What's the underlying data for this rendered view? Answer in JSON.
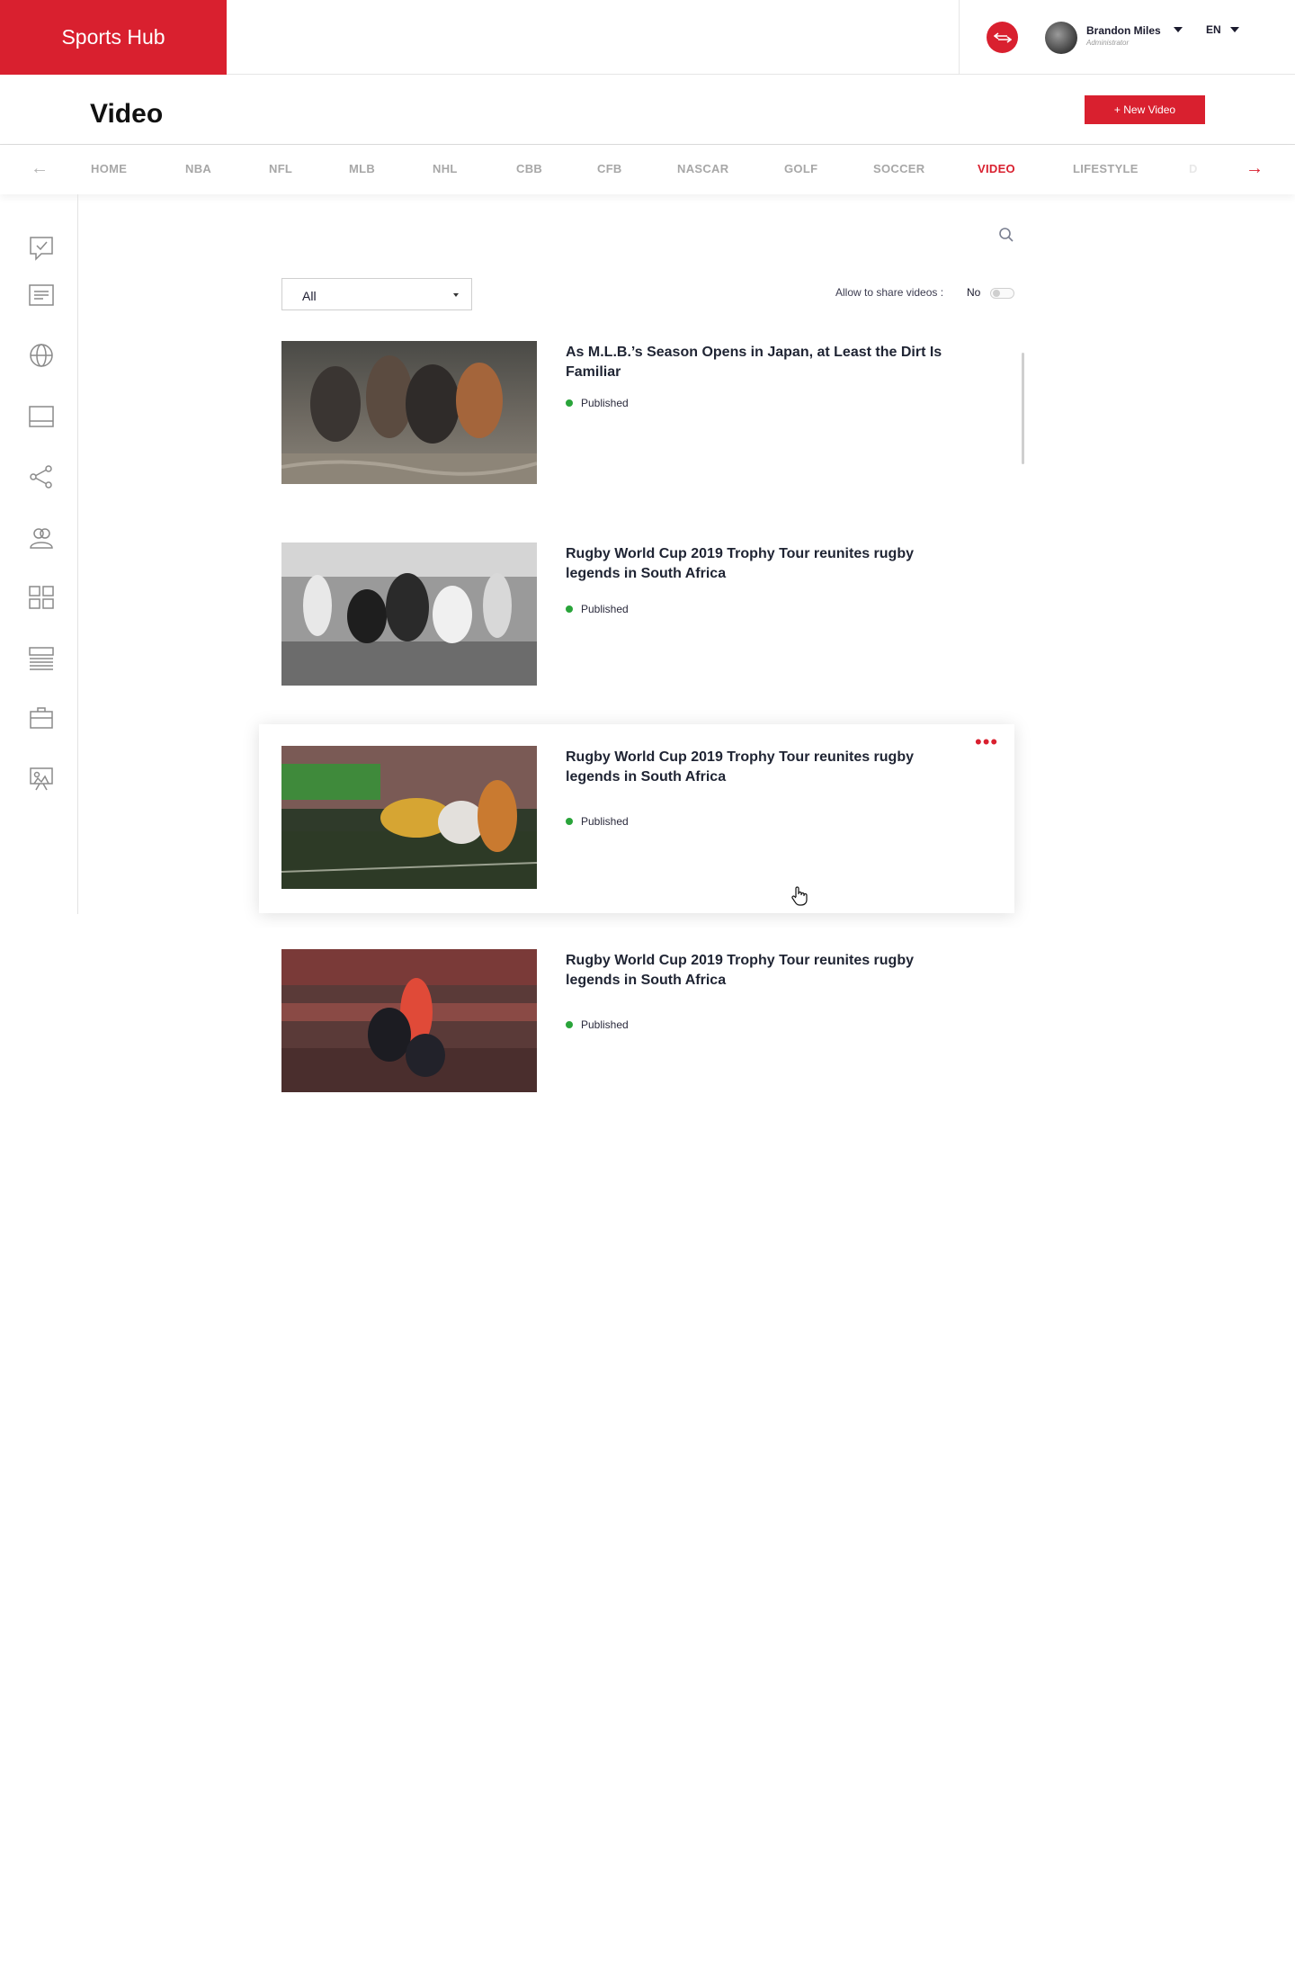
{
  "app": {
    "logo": "Sports Hub"
  },
  "user": {
    "name": "Brandon Miles",
    "role": "Administrator"
  },
  "language": "EN",
  "page": {
    "title": "Video",
    "new_button": "+ New Video"
  },
  "nav": {
    "items": [
      "HOME",
      "NBA",
      "NFL",
      "MLB",
      "NHL",
      "CBB",
      "CFB",
      "NASCAR",
      "GOLF",
      "SOCCER",
      "VIDEO",
      "LIFESTYLE"
    ],
    "active": "VIDEO",
    "faded_item": "D"
  },
  "sidebar": {
    "icons": [
      "survey-icon",
      "news-icon",
      "globe-icon",
      "banner-icon",
      "share-icon",
      "users-icon",
      "layout-icon",
      "list-icon",
      "briefcase-icon",
      "presentation-icon"
    ]
  },
  "filter": {
    "selected": "All"
  },
  "share": {
    "label": "Allow to share videos :",
    "value": "No"
  },
  "videos": [
    {
      "title": "As M.L.B.’s Season Opens in Japan, at Least the Dirt Is Familiar",
      "status": "Published"
    },
    {
      "title": "Rugby World Cup 2019 Trophy Tour reunites rugby legends in South Africa",
      "status": "Published"
    },
    {
      "title": "Rugby World Cup 2019 Trophy Tour reunites rugby legends in South Africa",
      "status": "Published"
    },
    {
      "title": "Rugby World Cup 2019 Trophy Tour reunites rugby legends in South Africa",
      "status": "Published"
    }
  ],
  "colors": {
    "brand": "#d9202f",
    "published": "#29a43a",
    "text": "#1f2433"
  }
}
